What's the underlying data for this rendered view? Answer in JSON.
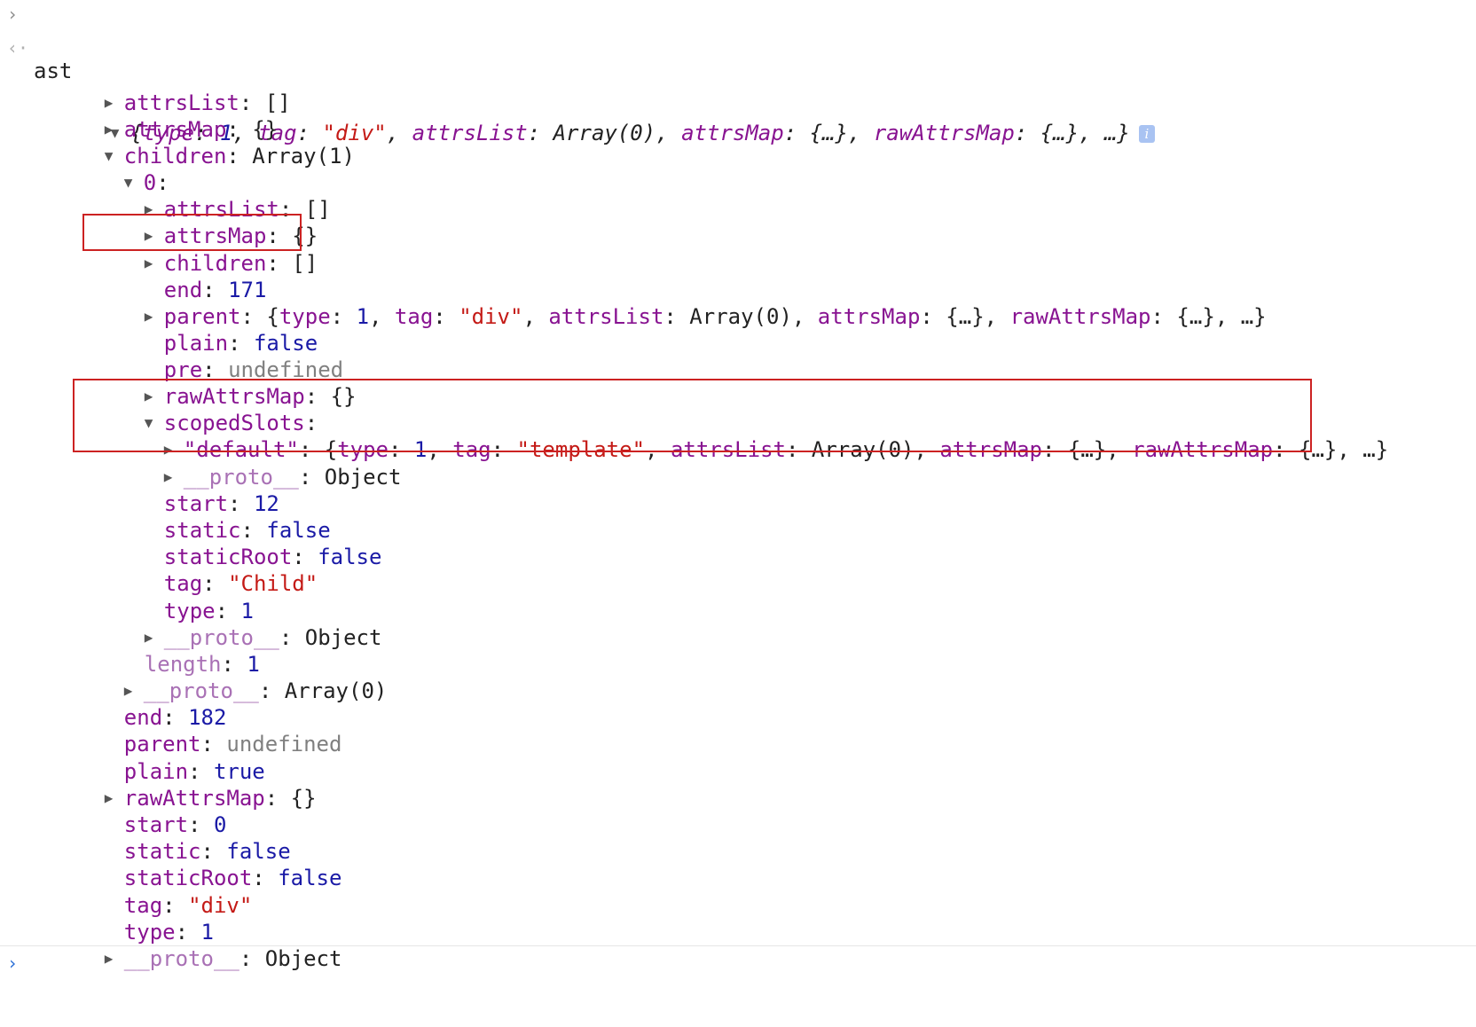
{
  "input": {
    "command": "ast"
  },
  "result": {
    "preview_open": "{",
    "type_key": "type",
    "type_val": "1",
    "tag_key": "tag",
    "tag_val": "\"div\"",
    "attrsList_key": "attrsList",
    "attrsList_val": "Array(0)",
    "attrsMap_key": "attrsMap",
    "attrsMap_val": "{…}",
    "rawAttrsMap_key": "rawAttrsMap",
    "rawAttrsMap_val": "{…}",
    "preview_tail": "…}",
    "info_glyph": "i"
  },
  "tree": {
    "attrsList": {
      "key": "attrsList",
      "val": "[]"
    },
    "attrsMap": {
      "key": "attrsMap",
      "val": "{}"
    },
    "children": {
      "key": "children",
      "val": "Array(1)"
    },
    "child0": {
      "key": "0",
      "attrsList": {
        "key": "attrsList",
        "val": "[]"
      },
      "attrsMap": {
        "key": "attrsMap",
        "val": "{}"
      },
      "children": {
        "key": "children",
        "val": "[]"
      },
      "end": {
        "key": "end",
        "val": "171"
      },
      "parent": {
        "key": "parent",
        "open": "{",
        "type_key": "type",
        "type_val": "1",
        "tag_key": "tag",
        "tag_val": "\"div\"",
        "attrsList_key": "attrsList",
        "attrsList_val": "Array(0)",
        "attrsMap_key": "attrsMap",
        "attrsMap_val": "{…}",
        "rawAttrsMap_key": "rawAttrsMap",
        "rawAttrsMap_val": "{…}",
        "tail": "…}"
      },
      "plain": {
        "key": "plain",
        "val": "false"
      },
      "pre": {
        "key": "pre",
        "val": "undefined"
      },
      "rawAttrsMap": {
        "key": "rawAttrsMap",
        "val": "{}"
      },
      "scopedSlots": {
        "key": "scopedSlots",
        "default": {
          "key": "\"default\"",
          "open": "{",
          "type_key": "type",
          "type_val": "1",
          "tag_key": "tag",
          "tag_val": "\"template\"",
          "attrsList_key": "attrsList",
          "attrsList_val": "Array(0)",
          "attrsMap_key": "attrsMap",
          "attrsMap_val": "{…}",
          "rawAttrsMap_key": "rawAttrsMap",
          "rawAttrsMap_val": "{…}",
          "tail": "…}"
        },
        "proto": {
          "key": "__proto__",
          "val": "Object"
        }
      },
      "start": {
        "key": "start",
        "val": "12"
      },
      "static": {
        "key": "static",
        "val": "false"
      },
      "staticRoot": {
        "key": "staticRoot",
        "val": "false"
      },
      "tag": {
        "key": "tag",
        "val": "\"Child\""
      },
      "type": {
        "key": "type",
        "val": "1"
      },
      "proto": {
        "key": "__proto__",
        "val": "Object"
      }
    },
    "length": {
      "key": "length",
      "val": "1"
    },
    "children_proto": {
      "key": "__proto__",
      "val": "Array(0)"
    },
    "end": {
      "key": "end",
      "val": "182"
    },
    "parent": {
      "key": "parent",
      "val": "undefined"
    },
    "plain": {
      "key": "plain",
      "val": "true"
    },
    "rawAttrsMap": {
      "key": "rawAttrsMap",
      "val": "{}"
    },
    "start": {
      "key": "start",
      "val": "0"
    },
    "static": {
      "key": "static",
      "val": "false"
    },
    "staticRoot": {
      "key": "staticRoot",
      "val": "false"
    },
    "tag": {
      "key": "tag",
      "val": "\"div\""
    },
    "type": {
      "key": "type",
      "val": "1"
    },
    "proto": {
      "key": "__proto__",
      "val": "Object"
    }
  },
  "icons": {
    "input_prompt": "chevron-right-icon",
    "result_marker": "return-arrow-icon",
    "expand": "triangle-right-icon",
    "collapse": "triangle-down-icon",
    "info": "info-icon",
    "caret": "prompt-caret-icon"
  },
  "colors": {
    "key": "#881391",
    "number": "#1a1aa6",
    "string": "#c41a16",
    "undefined": "#808080",
    "highlight_box": "#cc2222"
  }
}
